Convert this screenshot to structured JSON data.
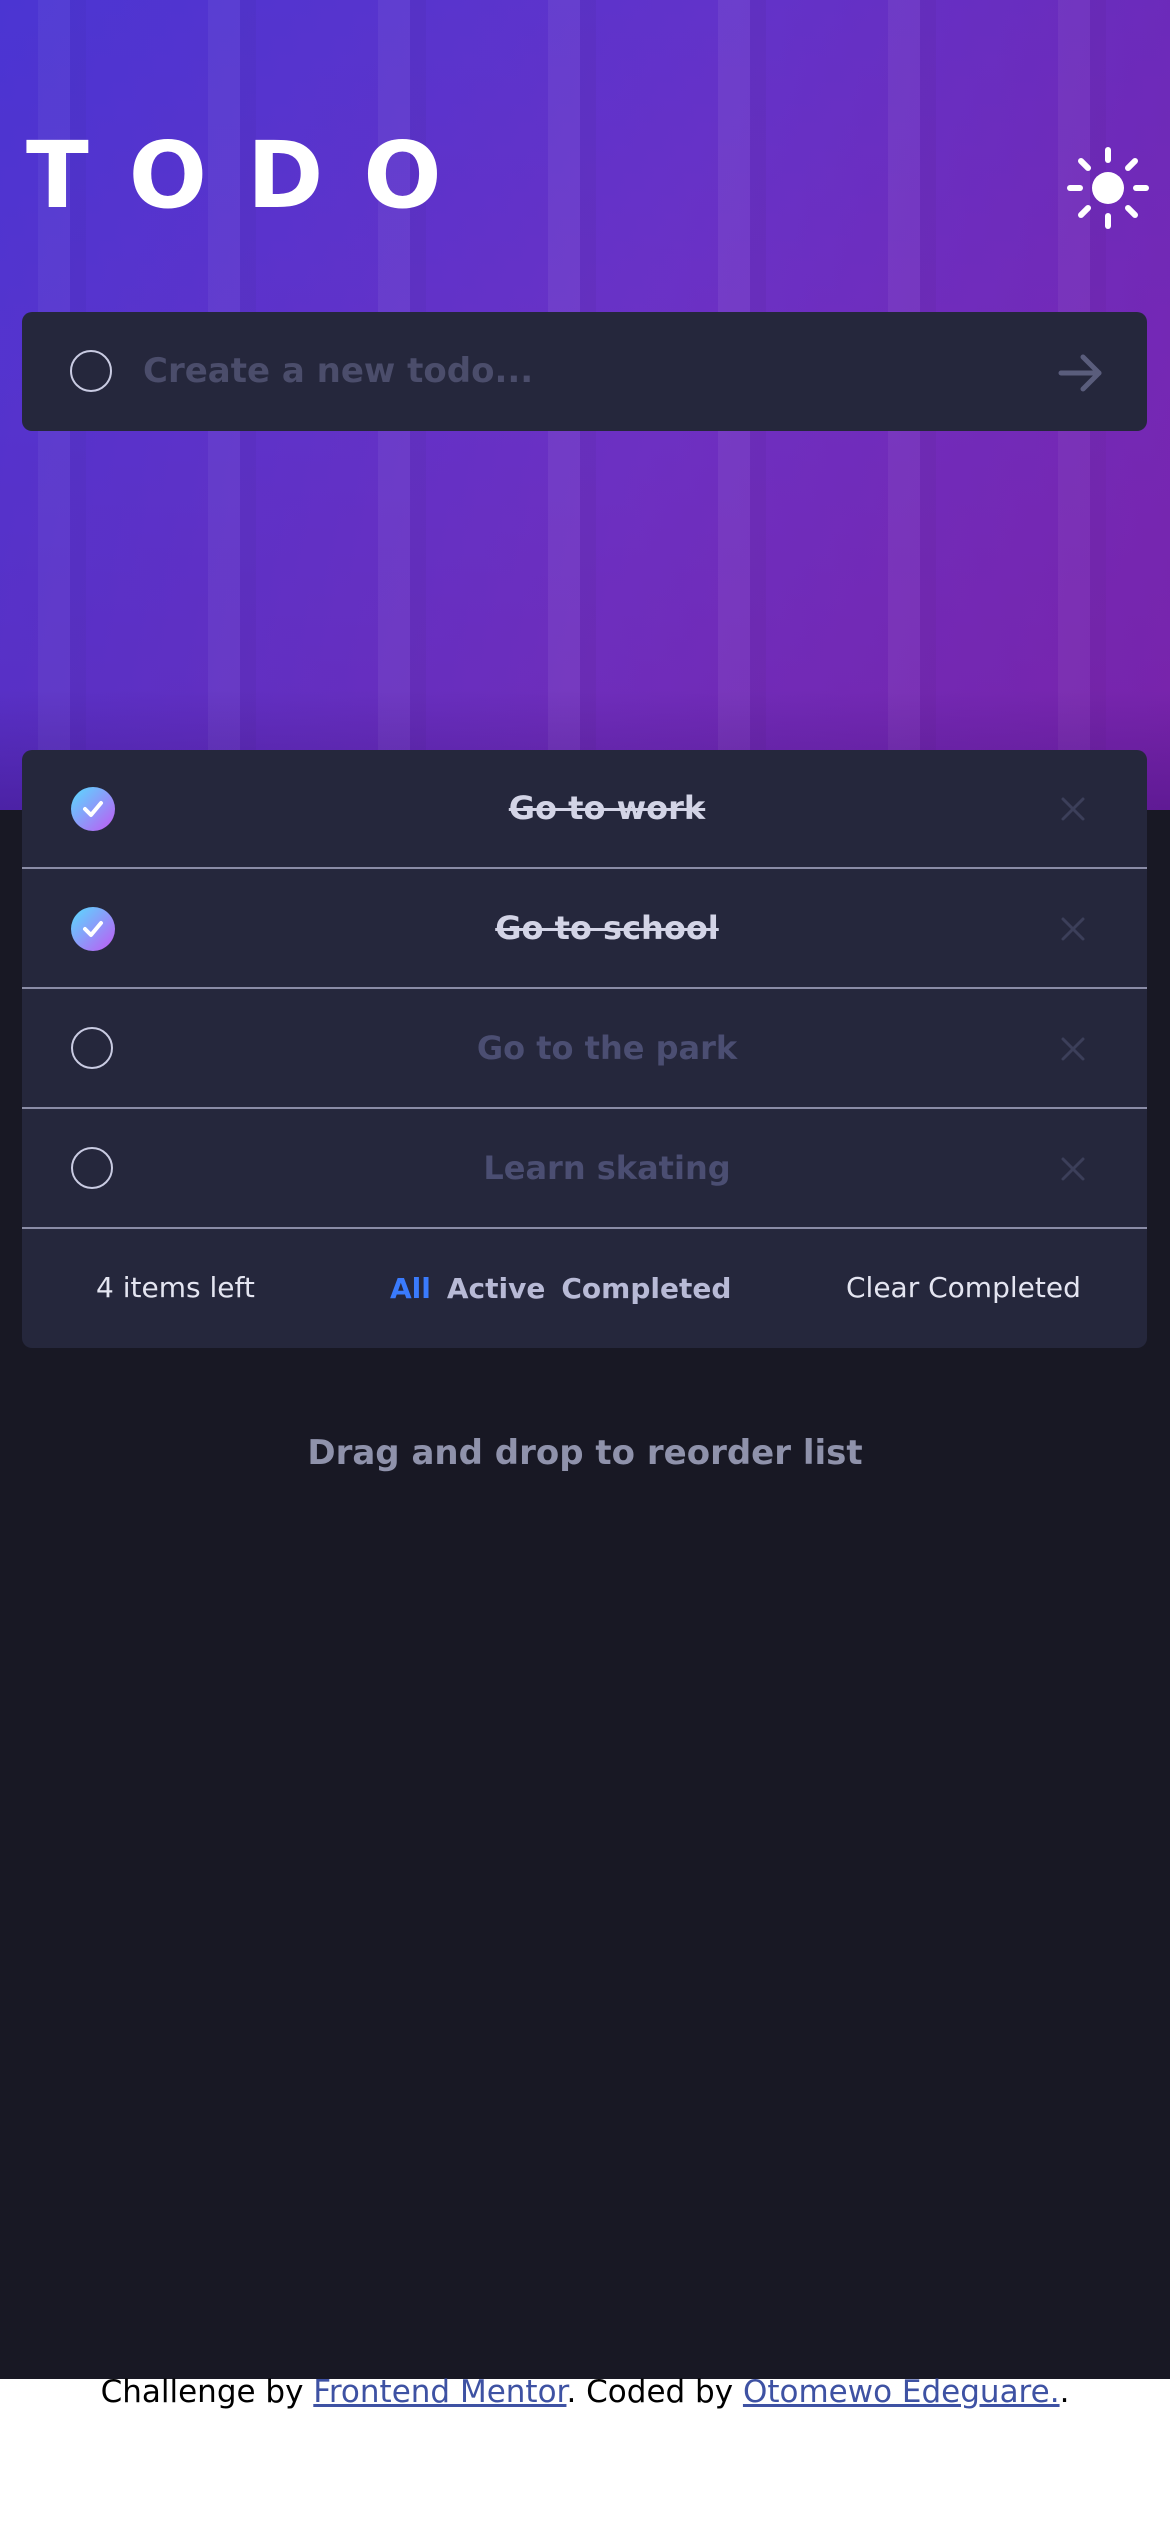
{
  "header": {
    "title": "TODO",
    "theme_icon": "sun-icon"
  },
  "new_todo": {
    "placeholder": "Create a new todo...",
    "value": "",
    "submit_icon": "arrow-right-icon"
  },
  "todos": [
    {
      "text": "Go to work",
      "completed": true
    },
    {
      "text": "Go to school",
      "completed": true
    },
    {
      "text": "Go to the park",
      "completed": false
    },
    {
      "text": "Learn skating",
      "completed": false
    }
  ],
  "footer": {
    "items_left": "4 items left",
    "filters": [
      "All",
      "Active",
      "Completed"
    ],
    "active_filter": "All",
    "clear_label": "Clear Completed"
  },
  "hint": "Drag and drop to reorder list",
  "attribution": {
    "prefix": "Challenge by ",
    "link1": "Frontend Mentor",
    "middle": ". Coded by ",
    "link2": "Otomewo Edeguare.",
    "suffix": "."
  },
  "colors": {
    "card": "#25273c",
    "page": "#181824",
    "accent": "#3a7bfd",
    "check_gradient_start": "#57ddff",
    "check_gradient_end": "#c058f3"
  }
}
